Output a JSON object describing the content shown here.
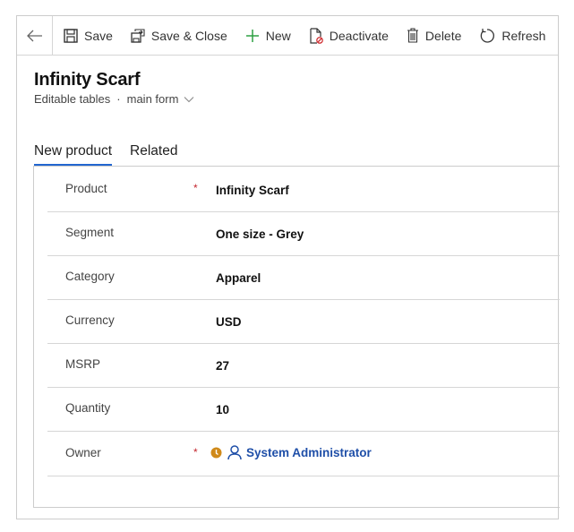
{
  "toolbar": {
    "back": "back",
    "commands": [
      {
        "label": "Save",
        "icon": "save-icon"
      },
      {
        "label": "Save & Close",
        "icon": "save-close-icon"
      },
      {
        "label": "New",
        "icon": "plus-icon"
      },
      {
        "label": "Deactivate",
        "icon": "deactivate-icon"
      },
      {
        "label": "Delete",
        "icon": "trash-icon"
      },
      {
        "label": "Refresh",
        "icon": "refresh-icon"
      }
    ]
  },
  "header": {
    "title": "Infinity Scarf",
    "entity": "Editable tables",
    "separator": "·",
    "form": "main form"
  },
  "tabs": [
    {
      "label": "New product",
      "active": true
    },
    {
      "label": "Related",
      "active": false
    }
  ],
  "fields": [
    {
      "label": "Product",
      "required": true,
      "value": "Infinity Scarf"
    },
    {
      "label": "Segment",
      "required": false,
      "value": "One size - Grey"
    },
    {
      "label": "Category",
      "required": false,
      "value": "Apparel"
    },
    {
      "label": "Currency",
      "required": false,
      "value": "USD"
    },
    {
      "label": "MSRP",
      "required": false,
      "value": "27"
    },
    {
      "label": "Quantity",
      "required": false,
      "value": "10"
    },
    {
      "label": "Owner",
      "required": true,
      "value": "System Administrator"
    }
  ],
  "required_marker": "*",
  "colors": {
    "accent": "#2266d0",
    "link": "#1f4fa8",
    "required": "#c4262e",
    "presence": "#d08a1a",
    "new_icon": "#2ea043"
  }
}
